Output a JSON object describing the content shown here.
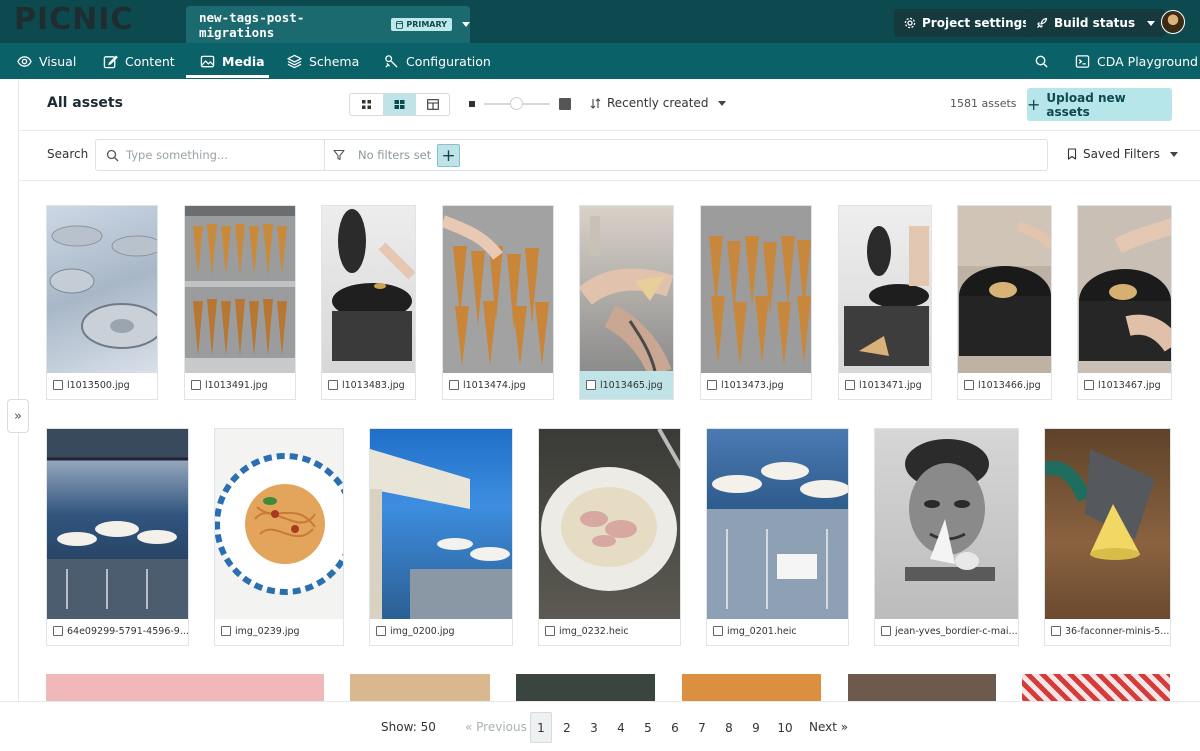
{
  "brand": {
    "logo": "PICNIC"
  },
  "branch": {
    "name": "new-tags-post-migrations",
    "badge": "PRIMARY"
  },
  "top_actions": {
    "project_settings": "Project settings",
    "build_status": "Build status"
  },
  "nav": {
    "items": [
      {
        "label": "Visual",
        "icon": "eye-icon"
      },
      {
        "label": "Content",
        "icon": "edit-icon"
      },
      {
        "label": "Media",
        "icon": "image-icon",
        "active": true
      },
      {
        "label": "Schema",
        "icon": "layers-icon"
      },
      {
        "label": "Configuration",
        "icon": "wrench-icon"
      }
    ],
    "search_icon": "search-icon",
    "playground": "CDA Playground"
  },
  "toolbar": {
    "title": "All assets",
    "sort_label": "Recently created",
    "asset_count": "1581 assets",
    "upload_label": "Upload new assets"
  },
  "search": {
    "label": "Search",
    "placeholder": "Type something...",
    "filters_text": "No filters set",
    "saved_filters": "Saved Filters"
  },
  "assets_row1": [
    {
      "name": "l1013500.jpg"
    },
    {
      "name": "l1013491.jpg"
    },
    {
      "name": "l1013483.jpg"
    },
    {
      "name": "l1013474.jpg"
    },
    {
      "name": "l1013465.jpg",
      "selected": true
    },
    {
      "name": "l1013473.jpg"
    },
    {
      "name": "l1013471.jpg"
    },
    {
      "name": "l1013466.jpg"
    },
    {
      "name": "l1013467.jpg"
    }
  ],
  "assets_row2": [
    {
      "name": "64e09299-5791-4596-9..."
    },
    {
      "name": "img_0239.jpg"
    },
    {
      "name": "img_0200.jpg"
    },
    {
      "name": "img_0232.heic"
    },
    {
      "name": "img_0201.heic"
    },
    {
      "name": "jean-yves_bordier-c-mai..."
    },
    {
      "name": "36-faconner-minis-5..."
    }
  ],
  "pagination": {
    "show": "Show: 50",
    "previous": "« Previous",
    "pages": [
      "1",
      "2",
      "3",
      "4",
      "5",
      "6",
      "7",
      "8",
      "9",
      "10"
    ],
    "current": "1",
    "next": "Next »"
  },
  "colors": {
    "topbar": "#0d4a4f",
    "navbar": "#0a6168",
    "accent_light": "#bfe3e6",
    "upload_button": "#b7e6ea"
  }
}
